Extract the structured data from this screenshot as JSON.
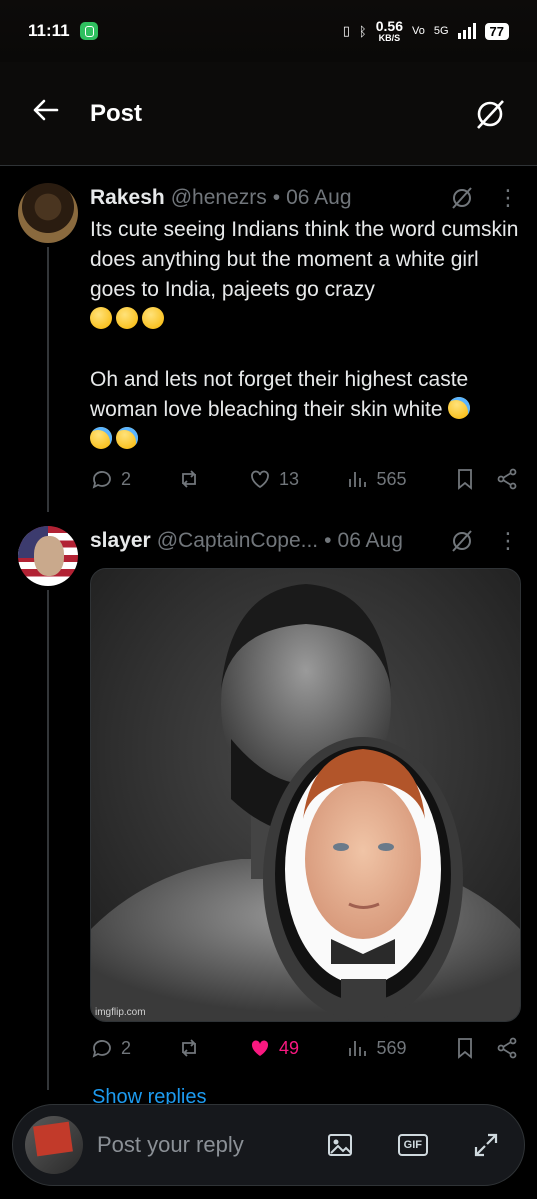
{
  "status_bar": {
    "time": "11:11",
    "net_speed": "0.56",
    "net_unit": "KB/S",
    "vo": "Vo",
    "five_g": "5G",
    "battery": "77"
  },
  "header": {
    "title": "Post"
  },
  "tweets": [
    {
      "name": "Rakesh",
      "handle": "@henezrs",
      "date": "06 Aug",
      "text_1": "Its cute seeing Indians think the word cumskin does anything but the moment a white girl goes to India, pajeets go crazy",
      "text_2": "Oh and lets not forget their highest caste woman love bleaching their skin white",
      "replies": "2",
      "likes": "13",
      "views": "565"
    },
    {
      "name": "slayer",
      "handle": "@CaptainCope...",
      "date": "06 Aug",
      "media_watermark": "imgflip.com",
      "replies": "2",
      "likes": "49",
      "views": "569"
    }
  ],
  "show_replies": "Show replies",
  "reply_bar": {
    "placeholder": "Post your reply",
    "gif_label": "GIF"
  },
  "colors": {
    "accent": "#1d9bf0",
    "like": "#f91880",
    "muted": "#71767b"
  }
}
